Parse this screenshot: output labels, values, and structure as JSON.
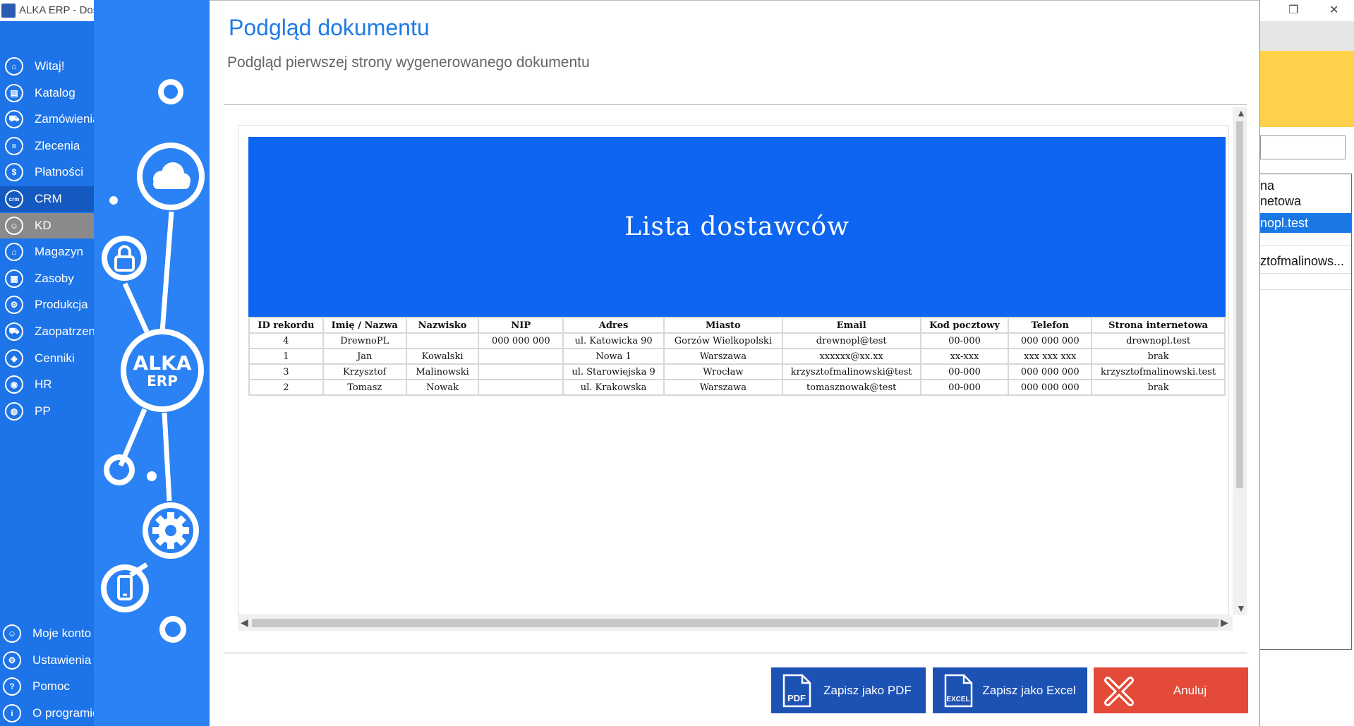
{
  "background_app": {
    "list_items": [
      "na",
      "netowa",
      "nopl.test",
      "ztofmalinows..."
    ]
  },
  "app": {
    "title": "ALKA ERP - Dos",
    "nav_top": [
      {
        "label": "Witaj!",
        "icon": "home-icon",
        "glyph": "⌂"
      },
      {
        "label": "Katalog",
        "icon": "book-icon",
        "glyph": "▤"
      },
      {
        "label": "Zamówienia",
        "icon": "cart-icon",
        "glyph": "⛟"
      },
      {
        "label": "Zlecenia",
        "icon": "list-icon",
        "glyph": "≡"
      },
      {
        "label": "Płatności",
        "icon": "dollar-icon",
        "glyph": "$"
      },
      {
        "label": "CRM",
        "icon": "crm-icon",
        "glyph": "crm"
      },
      {
        "label": "KD",
        "icon": "user-icon",
        "glyph": "☺"
      },
      {
        "label": "Magazyn",
        "icon": "warehouse-icon",
        "glyph": "⌂"
      },
      {
        "label": "Zasoby",
        "icon": "resources-icon",
        "glyph": "▦"
      },
      {
        "label": "Produkcja",
        "icon": "production-icon",
        "glyph": "⚙"
      },
      {
        "label": "Zaopatrzenie",
        "icon": "truck-icon",
        "glyph": "⛟"
      },
      {
        "label": "Cenniki",
        "icon": "tag-icon",
        "glyph": "◈"
      },
      {
        "label": "HR",
        "icon": "hr-icon",
        "glyph": "◉"
      },
      {
        "label": "PP",
        "icon": "pp-icon",
        "glyph": "◍"
      }
    ],
    "nav_bottom": [
      {
        "label": "Moje konto",
        "icon": "account-icon",
        "glyph": "☺"
      },
      {
        "label": "Ustawienia",
        "icon": "settings-icon",
        "glyph": "⚙"
      },
      {
        "label": "Pomoc",
        "icon": "help-icon",
        "glyph": "?"
      },
      {
        "label": "O programie",
        "icon": "info-icon",
        "glyph": "i"
      }
    ]
  },
  "dialog": {
    "title": "Podgląd dokumentu",
    "subtitle": "Podgląd pierwszej strony wygenerowanego dokumentu",
    "logo_top": "ALKA",
    "logo_bottom": "ERP",
    "document": {
      "title": "Lista dostawców",
      "columns": [
        "ID rekordu",
        "Imię / Nazwa",
        "Nazwisko",
        "NIP",
        "Adres",
        "Miasto",
        "Email",
        "Kod pocztowy",
        "Telefon",
        "Strona internetowa"
      ],
      "rows": [
        [
          "4",
          "DrewnoPL",
          "",
          "000 000 000",
          "ul. Katowicka 90",
          "Gorzów Wielkopolski",
          "drewnopl@test",
          "00-000",
          "000 000 000",
          "drewnopl.test"
        ],
        [
          "1",
          "Jan",
          "Kowalski",
          "",
          "Nowa 1",
          "Warszawa",
          "xxxxxx@xx.xx",
          "xx-xxx",
          "xxx xxx xxx",
          "brak"
        ],
        [
          "3",
          "Krzysztof",
          "Malinowski",
          "",
          "ul. Starowiejska 9",
          "Wrocław",
          "krzysztofmalinowski@test",
          "00-000",
          "000 000 000",
          "krzysztofmalinowski.test"
        ],
        [
          "2",
          "Tomasz",
          "Nowak",
          "",
          "ul. Krakowska",
          "Warszawa",
          "tomasznowak@test",
          "00-000",
          "000 000 000",
          "brak"
        ]
      ]
    },
    "buttons": {
      "pdf_label": "Zapisz jako PDF",
      "pdf_icon_text": "PDF",
      "excel_label": "Zapisz jako Excel",
      "excel_icon_text": "EXCEL",
      "cancel_label": "Anuluj"
    }
  }
}
